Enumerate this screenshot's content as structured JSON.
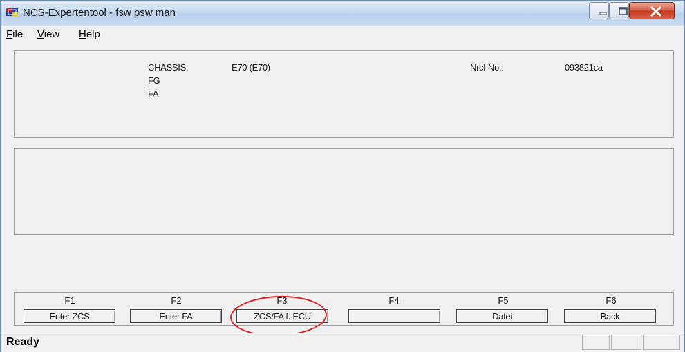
{
  "window": {
    "title": "NCS-Expertentool - fsw psw man"
  },
  "menu": [
    {
      "underline": "F",
      "rest": "ile"
    },
    {
      "underline": "V",
      "rest": "iew"
    },
    {
      "underline": "H",
      "rest": "elp"
    }
  ],
  "info": {
    "chassis_label": "CHASSIS:",
    "chassis_value": "E70 (E70)",
    "fg_label": "FG",
    "fa_label": "FA",
    "nrcl_label": "Nrcl-No.:",
    "nrcl_value": "093821ca"
  },
  "function_keys": [
    {
      "key": "F1",
      "label": "Enter ZCS"
    },
    {
      "key": "F2",
      "label": "Enter FA"
    },
    {
      "key": "F3",
      "label": "ZCS/FA f. ECU"
    },
    {
      "key": "F4",
      "label": ""
    },
    {
      "key": "F5",
      "label": "Datei"
    },
    {
      "key": "F6",
      "label": "Back"
    }
  ],
  "status": {
    "text": "Ready"
  },
  "colors": {
    "annotation": "#e02020",
    "titlebar": "#c8daf0",
    "close": "#c2371c"
  },
  "icons": {
    "app": "ncs-app-icon",
    "minimize": "minimize-icon",
    "maximize": "maximize-icon",
    "close": "close-icon"
  }
}
